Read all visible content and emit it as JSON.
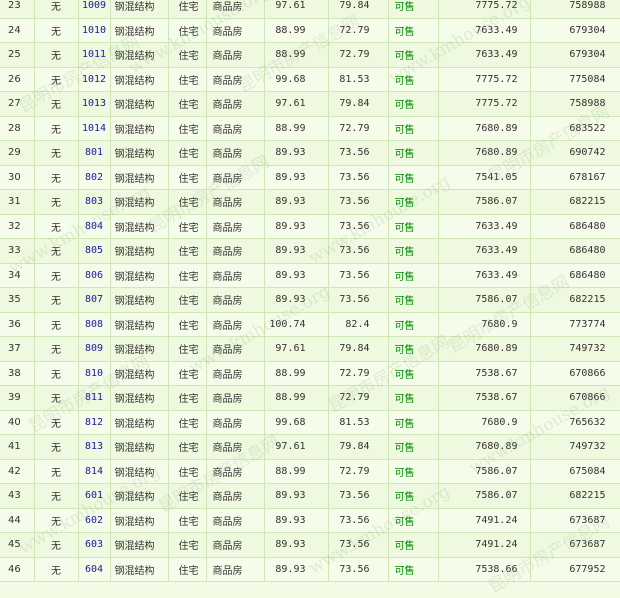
{
  "rows": [
    {
      "idx": "23",
      "floor": "无",
      "room": "1009",
      "struct": "钢混结构",
      "use": "住宅",
      "type": "商品房",
      "area1": "97.61",
      "area2": "79.84",
      "status": "可售",
      "price": "7775.72",
      "total": "758988"
    },
    {
      "idx": "24",
      "floor": "无",
      "room": "1010",
      "struct": "钢混结构",
      "use": "住宅",
      "type": "商品房",
      "area1": "88.99",
      "area2": "72.79",
      "status": "可售",
      "price": "7633.49",
      "total": "679304"
    },
    {
      "idx": "25",
      "floor": "无",
      "room": "1011",
      "struct": "钢混结构",
      "use": "住宅",
      "type": "商品房",
      "area1": "88.99",
      "area2": "72.79",
      "status": "可售",
      "price": "7633.49",
      "total": "679304"
    },
    {
      "idx": "26",
      "floor": "无",
      "room": "1012",
      "struct": "钢混结构",
      "use": "住宅",
      "type": "商品房",
      "area1": "99.68",
      "area2": "81.53",
      "status": "可售",
      "price": "7775.72",
      "total": "775084"
    },
    {
      "idx": "27",
      "floor": "无",
      "room": "1013",
      "struct": "钢混结构",
      "use": "住宅",
      "type": "商品房",
      "area1": "97.61",
      "area2": "79.84",
      "status": "可售",
      "price": "7775.72",
      "total": "758988"
    },
    {
      "idx": "28",
      "floor": "无",
      "room": "1014",
      "struct": "钢混结构",
      "use": "住宅",
      "type": "商品房",
      "area1": "88.99",
      "area2": "72.79",
      "status": "可售",
      "price": "7680.89",
      "total": "683522"
    },
    {
      "idx": "29",
      "floor": "无",
      "room": "801",
      "struct": "钢混结构",
      "use": "住宅",
      "type": "商品房",
      "area1": "89.93",
      "area2": "73.56",
      "status": "可售",
      "price": "7680.89",
      "total": "690742"
    },
    {
      "idx": "30",
      "floor": "无",
      "room": "802",
      "struct": "钢混结构",
      "use": "住宅",
      "type": "商品房",
      "area1": "89.93",
      "area2": "73.56",
      "status": "可售",
      "price": "7541.05",
      "total": "678167"
    },
    {
      "idx": "31",
      "floor": "无",
      "room": "803",
      "struct": "钢混结构",
      "use": "住宅",
      "type": "商品房",
      "area1": "89.93",
      "area2": "73.56",
      "status": "可售",
      "price": "7586.07",
      "total": "682215"
    },
    {
      "idx": "32",
      "floor": "无",
      "room": "804",
      "struct": "钢混结构",
      "use": "住宅",
      "type": "商品房",
      "area1": "89.93",
      "area2": "73.56",
      "status": "可售",
      "price": "7633.49",
      "total": "686480"
    },
    {
      "idx": "33",
      "floor": "无",
      "room": "805",
      "struct": "钢混结构",
      "use": "住宅",
      "type": "商品房",
      "area1": "89.93",
      "area2": "73.56",
      "status": "可售",
      "price": "7633.49",
      "total": "686480"
    },
    {
      "idx": "34",
      "floor": "无",
      "room": "806",
      "struct": "钢混结构",
      "use": "住宅",
      "type": "商品房",
      "area1": "89.93",
      "area2": "73.56",
      "status": "可售",
      "price": "7633.49",
      "total": "686480"
    },
    {
      "idx": "35",
      "floor": "无",
      "room": "807",
      "struct": "钢混结构",
      "use": "住宅",
      "type": "商品房",
      "area1": "89.93",
      "area2": "73.56",
      "status": "可售",
      "price": "7586.07",
      "total": "682215"
    },
    {
      "idx": "36",
      "floor": "无",
      "room": "808",
      "struct": "钢混结构",
      "use": "住宅",
      "type": "商品房",
      "area1": "100.74",
      "area2": "82.4",
      "status": "可售",
      "price": "7680.9",
      "total": "773774"
    },
    {
      "idx": "37",
      "floor": "无",
      "room": "809",
      "struct": "钢混结构",
      "use": "住宅",
      "type": "商品房",
      "area1": "97.61",
      "area2": "79.84",
      "status": "可售",
      "price": "7680.89",
      "total": "749732"
    },
    {
      "idx": "38",
      "floor": "无",
      "room": "810",
      "struct": "钢混结构",
      "use": "住宅",
      "type": "商品房",
      "area1": "88.99",
      "area2": "72.79",
      "status": "可售",
      "price": "7538.67",
      "total": "670866"
    },
    {
      "idx": "39",
      "floor": "无",
      "room": "811",
      "struct": "钢混结构",
      "use": "住宅",
      "type": "商品房",
      "area1": "88.99",
      "area2": "72.79",
      "status": "可售",
      "price": "7538.67",
      "total": "670866"
    },
    {
      "idx": "40",
      "floor": "无",
      "room": "812",
      "struct": "钢混结构",
      "use": "住宅",
      "type": "商品房",
      "area1": "99.68",
      "area2": "81.53",
      "status": "可售",
      "price": "7680.9",
      "total": "765632"
    },
    {
      "idx": "41",
      "floor": "无",
      "room": "813",
      "struct": "钢混结构",
      "use": "住宅",
      "type": "商品房",
      "area1": "97.61",
      "area2": "79.84",
      "status": "可售",
      "price": "7680.89",
      "total": "749732"
    },
    {
      "idx": "42",
      "floor": "无",
      "room": "814",
      "struct": "钢混结构",
      "use": "住宅",
      "type": "商品房",
      "area1": "88.99",
      "area2": "72.79",
      "status": "可售",
      "price": "7586.07",
      "total": "675084"
    },
    {
      "idx": "43",
      "floor": "无",
      "room": "601",
      "struct": "钢混结构",
      "use": "住宅",
      "type": "商品房",
      "area1": "89.93",
      "area2": "73.56",
      "status": "可售",
      "price": "7586.07",
      "total": "682215"
    },
    {
      "idx": "44",
      "floor": "无",
      "room": "602",
      "struct": "钢混结构",
      "use": "住宅",
      "type": "商品房",
      "area1": "89.93",
      "area2": "73.56",
      "status": "可售",
      "price": "7491.24",
      "total": "673687"
    },
    {
      "idx": "45",
      "floor": "无",
      "room": "603",
      "struct": "钢混结构",
      "use": "住宅",
      "type": "商品房",
      "area1": "89.93",
      "area2": "73.56",
      "status": "可售",
      "price": "7491.24",
      "total": "673687"
    },
    {
      "idx": "46",
      "floor": "无",
      "room": "604",
      "struct": "钢混结构",
      "use": "住宅",
      "type": "商品房",
      "area1": "89.93",
      "area2": "73.56",
      "status": "可售",
      "price": "7538.66",
      "total": "677952"
    }
  ],
  "watermark": {
    "cn": "昆明市房产信息网",
    "en": "www.kmhouse.org"
  },
  "colors": {
    "status": "#008a00",
    "room": "#1a1a99",
    "grid": "#cfe6b6"
  }
}
